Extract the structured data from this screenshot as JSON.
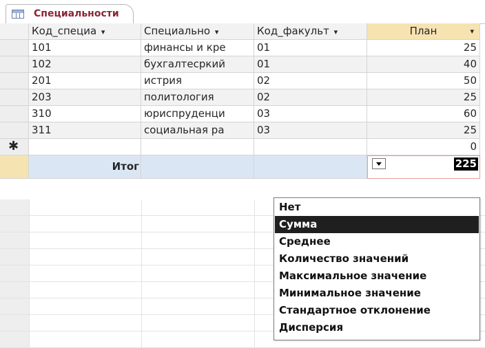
{
  "tab": {
    "title": "Специальности"
  },
  "columns": [
    {
      "label": "Код_специа",
      "arrow": "▾"
    },
    {
      "label": "Специально",
      "arrow": "▾"
    },
    {
      "label": "Код_факульт",
      "arrow": "▾"
    },
    {
      "label": "План",
      "arrow": "▾"
    }
  ],
  "rows": [
    {
      "code": "101",
      "name": "финансы и кре",
      "faculty": "01",
      "plan": "25"
    },
    {
      "code": "102",
      "name": "бухгалтесркий",
      "faculty": "01",
      "plan": "40"
    },
    {
      "code": "201",
      "name": "истрия",
      "faculty": "02",
      "plan": "50"
    },
    {
      "code": "203",
      "name": "политология",
      "faculty": "02",
      "plan": "25"
    },
    {
      "code": "310",
      "name": "юриспруденци",
      "faculty": "03",
      "plan": "60"
    },
    {
      "code": "311",
      "name": "социальная ра",
      "faculty": "03",
      "plan": "25"
    }
  ],
  "new_row": {
    "marker": "✱",
    "plan": "0"
  },
  "totals": {
    "label": "Итог",
    "value": "225"
  },
  "aggregate_menu": {
    "selected_index": 1,
    "items": [
      "Нет",
      "Сумма",
      "Среднее",
      "Количество значений",
      "Максимальное значение",
      "Минимальное значение",
      "Стандартное отклонение",
      "Дисперсия"
    ]
  },
  "colors": {
    "tab_title": "#8b2434",
    "active_header": "#f6e3b2",
    "totals_row": "#dbe6f4",
    "menu_highlight": "#1f1f1f"
  }
}
